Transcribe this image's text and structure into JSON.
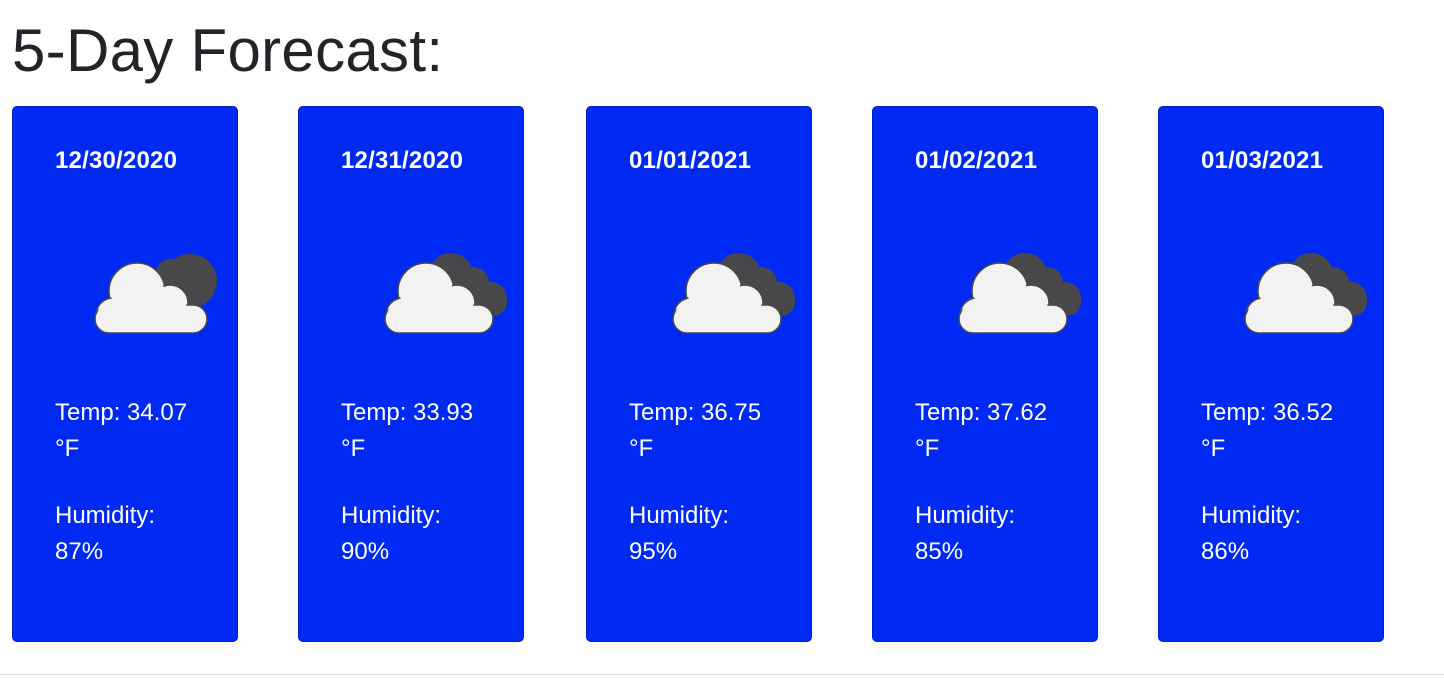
{
  "header": {
    "title": "5-Day Forecast:"
  },
  "forecast": [
    {
      "date": "12/30/2020",
      "icon": "cloud-night-icon",
      "temp_label": "Temp: 34.07",
      "temp_unit": "°F",
      "humidity_label": "Humidity:",
      "humidity_value": "87%"
    },
    {
      "date": "12/31/2020",
      "icon": "cloud-broken-icon",
      "temp_label": "Temp: 33.93",
      "temp_unit": "°F",
      "humidity_label": "Humidity:",
      "humidity_value": "90%"
    },
    {
      "date": "01/01/2021",
      "icon": "cloud-broken-icon",
      "temp_label": "Temp: 36.75",
      "temp_unit": "°F",
      "humidity_label": "Humidity:",
      "humidity_value": "95%"
    },
    {
      "date": "01/02/2021",
      "icon": "cloud-broken-icon",
      "temp_label": "Temp: 37.62",
      "temp_unit": "°F",
      "humidity_label": "Humidity:",
      "humidity_value": "85%"
    },
    {
      "date": "01/03/2021",
      "icon": "cloud-broken-icon",
      "temp_label": "Temp: 36.52",
      "temp_unit": "°F",
      "humidity_label": "Humidity:",
      "humidity_value": "86%"
    }
  ],
  "colors": {
    "card_bg": "#0029f4",
    "card_text": "#ffffff",
    "title_text": "#212529",
    "cloud_front": "#f2f2f2",
    "cloud_back": "#48484a"
  }
}
